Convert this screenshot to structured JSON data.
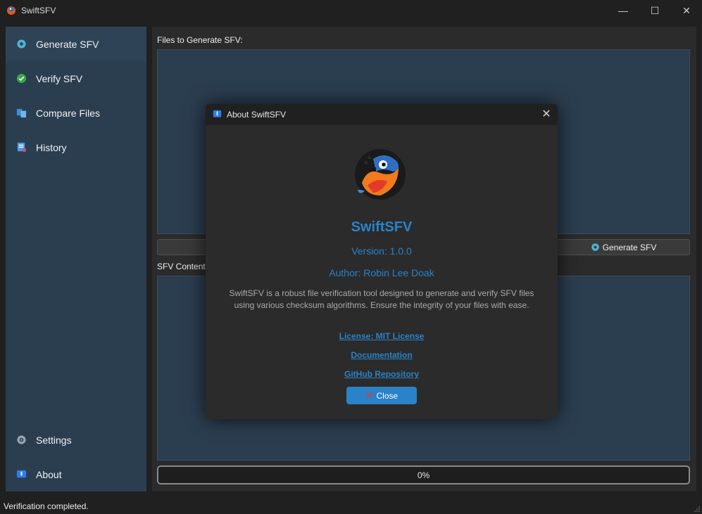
{
  "window": {
    "title": "SwiftSFV",
    "minimize_glyph": "—",
    "maximize_glyph": "☐",
    "close_glyph": "✕"
  },
  "sidebar": {
    "items": [
      {
        "label": "Generate SFV",
        "icon": "gear-icon"
      },
      {
        "label": "Verify SFV",
        "icon": "check-circle-icon"
      },
      {
        "label": "Compare Files",
        "icon": "compare-icon"
      },
      {
        "label": "History",
        "icon": "history-icon"
      }
    ],
    "bottom_items": [
      {
        "label": "Settings",
        "icon": "settings-icon"
      },
      {
        "label": "About",
        "icon": "info-icon"
      }
    ]
  },
  "main": {
    "files_label": "Files to Generate SFV:",
    "generate_button": "Generate SFV",
    "sfv_label": "SFV Content:",
    "progress_text": "0%"
  },
  "status": {
    "text": "Verification completed."
  },
  "about_dialog": {
    "title": "About SwiftSFV",
    "app_name": "SwiftSFV",
    "version": "Version: 1.0.0",
    "author": "Author: Robin Lee Doak",
    "description": "SwiftSFV is a robust file verification tool designed to generate and verify SFV files using various checksum algorithms. Ensure the integrity of your files with ease.",
    "links": [
      "License: MIT License",
      "Documentation",
      "GitHub Repository"
    ],
    "close_label": "Close",
    "close_glyph": "✕",
    "dialog_close_glyph": "✕"
  },
  "colors": {
    "accent": "#2a82c8",
    "sidebar_bg": "#2b3e50",
    "window_bg": "#202020",
    "panel_bg": "#2b2b2b"
  }
}
